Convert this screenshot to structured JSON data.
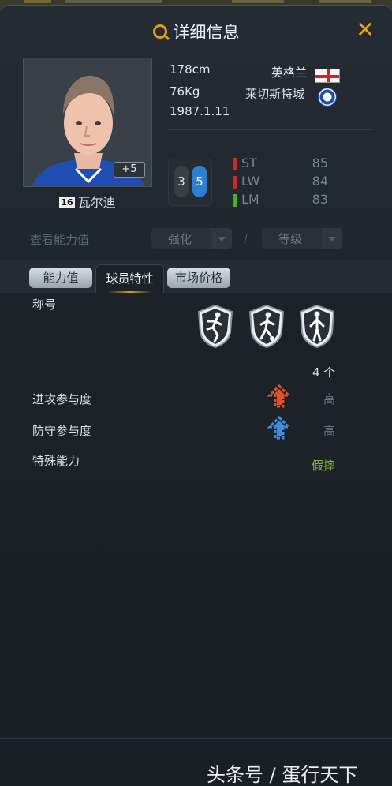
{
  "header": {
    "title": "详细信息"
  },
  "player": {
    "height": "178cm",
    "weight": "76Kg",
    "birth": "1987.1.11",
    "nation": "英格兰",
    "club": "莱切斯特城",
    "number": "16",
    "name": "瓦尔迪",
    "upgrade": "+5",
    "foot_left": "3",
    "foot_right": "5"
  },
  "positions": [
    {
      "pos": "ST",
      "rating": "85",
      "color": "#c92a2a"
    },
    {
      "pos": "LW",
      "rating": "84",
      "color": "#c92a2a"
    },
    {
      "pos": "LM",
      "rating": "83",
      "color": "#4caf2a"
    }
  ],
  "ability_bar": {
    "label": "查看能力值",
    "enhance": "强化",
    "separator": "/",
    "grade": "等级"
  },
  "tabs": [
    {
      "label": "能力值"
    },
    {
      "label": "球员特性"
    },
    {
      "label": "市场价格"
    }
  ],
  "traits": {
    "title_label": "称号",
    "count": "4 个",
    "attack_label": "进攻参与度",
    "attack_value": "高",
    "defense_label": "防守参与度",
    "defense_value": "高",
    "special_label": "特殊能力",
    "special_value": "假摔",
    "icons": [
      "runner-badge-icon",
      "dribbler-badge-icon",
      "standing-player-badge-icon"
    ]
  },
  "watermark": "头条号 / 蛋行天下",
  "colors": {
    "accent": "#e59a20",
    "attack_arrow": "#e0522a",
    "defense_arrow": "#3a8fe0",
    "skill": "#86b23a"
  }
}
